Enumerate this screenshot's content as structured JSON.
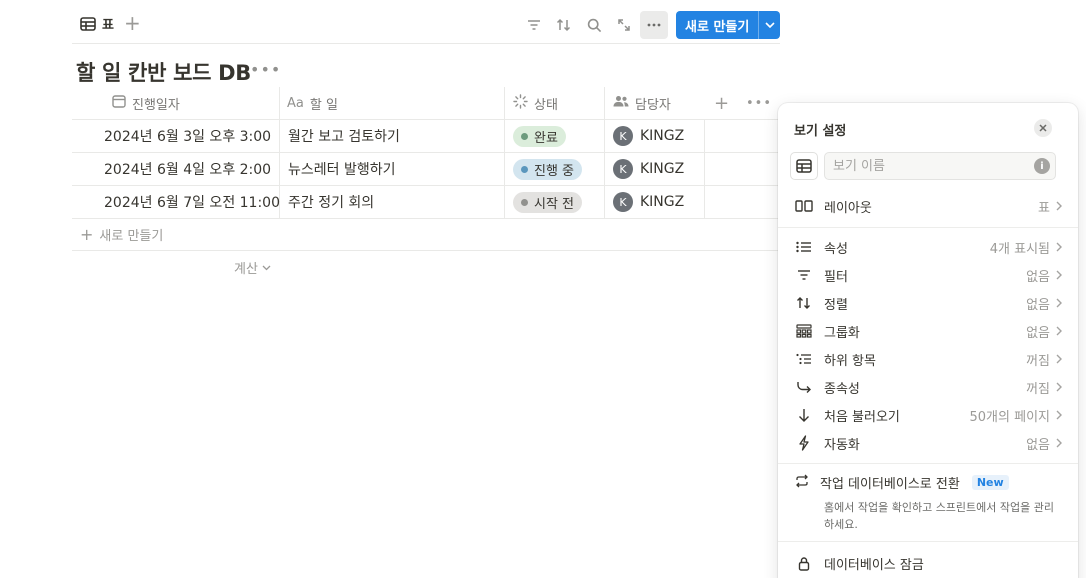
{
  "toolbar": {
    "view_tab_label": "표",
    "new_button_label": "새로 만들기"
  },
  "page": {
    "title": "할 일 칸반 보드 DB"
  },
  "table": {
    "columns": [
      {
        "label": "진행일자",
        "icon": "calendar-icon"
      },
      {
        "label": "할 일",
        "icon": "text-icon",
        "prefix": "Aa"
      },
      {
        "label": "상태",
        "icon": "status-icon"
      },
      {
        "label": "담당자",
        "icon": "people-icon"
      }
    ],
    "rows": [
      {
        "date": "2024년 6월 3일 오후 3:00",
        "task": "월간 보고 검토하기",
        "status": "완료",
        "status_color": "#dbeddb",
        "status_dot": "#6c9b7d",
        "assignee_initial": "K",
        "assignee": "KINGZ"
      },
      {
        "date": "2024년 6월 4일 오후 2:00",
        "task": "뉴스레터 발행하기",
        "status": "진행 중",
        "status_color": "#d3e5ef",
        "status_dot": "#5b97bd",
        "assignee_initial": "K",
        "assignee": "KINGZ"
      },
      {
        "date": "2024년 6월 7일 오전 11:00",
        "task": "주간 정기 회의",
        "status": "시작 전",
        "status_color": "#e3e2e0",
        "status_dot": "#91918e",
        "assignee_initial": "K",
        "assignee": "KINGZ"
      }
    ],
    "add_row_label": "새로 만들기",
    "calc_label": "계산"
  },
  "panel": {
    "title": "보기 설정",
    "name_placeholder": "보기 이름",
    "layout": {
      "label": "레이아웃",
      "value": "표"
    },
    "items": [
      {
        "label": "속성",
        "value": "4개 표시됨",
        "icon": "list-icon"
      },
      {
        "label": "필터",
        "value": "없음",
        "icon": "filter-icon"
      },
      {
        "label": "정렬",
        "value": "없음",
        "icon": "sort-icon"
      },
      {
        "label": "그룹화",
        "value": "없음",
        "icon": "group-icon"
      },
      {
        "label": "하위 항목",
        "value": "꺼짐",
        "icon": "subitem-icon"
      },
      {
        "label": "종속성",
        "value": "꺼짐",
        "icon": "dependency-icon"
      },
      {
        "label": "처음 불러오기",
        "value": "50개의 페이지",
        "icon": "arrow-down-icon"
      },
      {
        "label": "자동화",
        "value": "없음",
        "icon": "lightning-icon"
      }
    ],
    "convert_label": "작업 데이터베이스로 전환",
    "convert_badge": "New",
    "convert_desc": "홈에서 작업을 확인하고 스프린트에서 작업을 관리하세요.",
    "lock_label": "데이터베이스 잠금"
  }
}
